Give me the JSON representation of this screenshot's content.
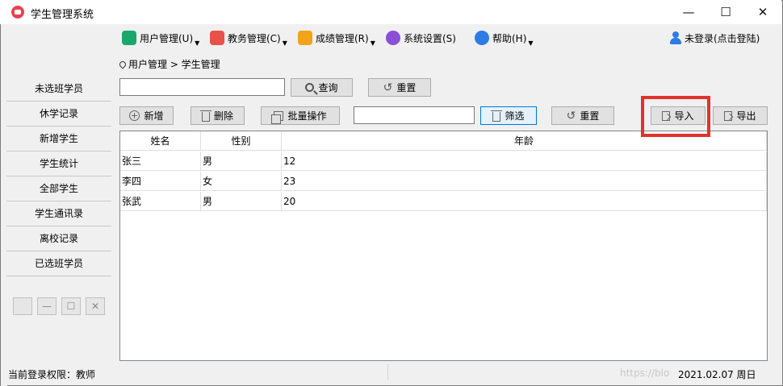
{
  "window": {
    "title": "学生管理系统",
    "minimize": "—",
    "maximize": "☐",
    "close": "✕"
  },
  "menubar": {
    "items": [
      {
        "label": "用户管理(U)",
        "color": "#1aa86a"
      },
      {
        "label": "教务管理(C)",
        "color": "#e8524a"
      },
      {
        "label": "成绩管理(R)",
        "color": "#f3a21c"
      },
      {
        "label": "系统设置(S)",
        "color": "#8a4fd6"
      },
      {
        "label": "帮助(H)",
        "color": "#2d7be5"
      }
    ],
    "dropdown_arrow": "▼",
    "login_status": "未登录(点击登陆)"
  },
  "sidebar": {
    "items": [
      "未选班学员",
      "休学记录",
      "新增学生",
      "学生统计",
      "全部学生",
      "学生通讯录",
      "离校记录",
      "已选班学员"
    ],
    "mini_buttons": [
      "",
      "—",
      "☐",
      "✕"
    ]
  },
  "breadcrumb": "用户管理 > 学生管理",
  "search": {
    "value": "",
    "query_label": "查询",
    "reset_label": "重置"
  },
  "toolbar": {
    "add_label": "新增",
    "delete_label": "删除",
    "batch_label": "批量操作",
    "filter_value": "",
    "filter_label": "筛选",
    "reset_label": "重置",
    "import_label": "导入",
    "export_label": "导出"
  },
  "grid": {
    "columns": [
      "姓名",
      "性别",
      "年龄"
    ],
    "rows": [
      [
        "张三",
        "男",
        "12"
      ],
      [
        "李四",
        "女",
        "23"
      ],
      [
        "张武",
        "男",
        "20"
      ]
    ]
  },
  "status": {
    "permission": "当前登录权限：教师",
    "datetime": "2021.02.07 周日",
    "watermark": "https://blo"
  },
  "colors": {
    "highlight": "#e3312d",
    "accent": "#0078d7"
  }
}
